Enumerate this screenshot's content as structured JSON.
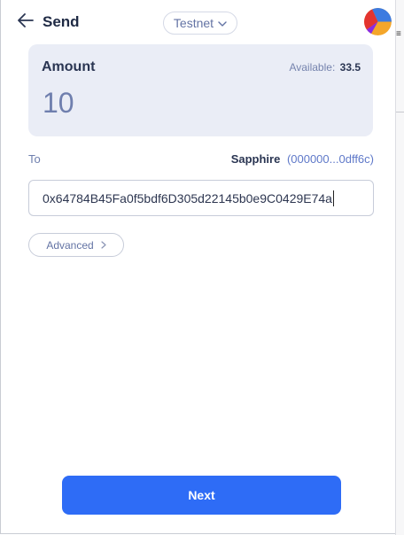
{
  "header": {
    "title": "Send",
    "network": "Testnet"
  },
  "amount": {
    "label": "Amount",
    "available_label": "Available:",
    "available_value": "33.5",
    "value": "10"
  },
  "recipient": {
    "to_label": "To",
    "name": "Sapphire",
    "short_address": "(000000...0dff6c)",
    "address_value": "0x64784B45Fa0f5bdf6D305d22145b0e9C0429E74a"
  },
  "advanced": {
    "label": "Advanced"
  },
  "footer": {
    "next_label": "Next"
  },
  "colors": {
    "primary": "#2e6cf6",
    "card_bg": "#eaedf6",
    "muted_text": "#6f7fae"
  },
  "icons": {
    "back": "arrow-left-icon",
    "network_dropdown": "chevron-down-icon",
    "advanced": "chevron-right-icon",
    "account": "account-avatar-icon"
  }
}
